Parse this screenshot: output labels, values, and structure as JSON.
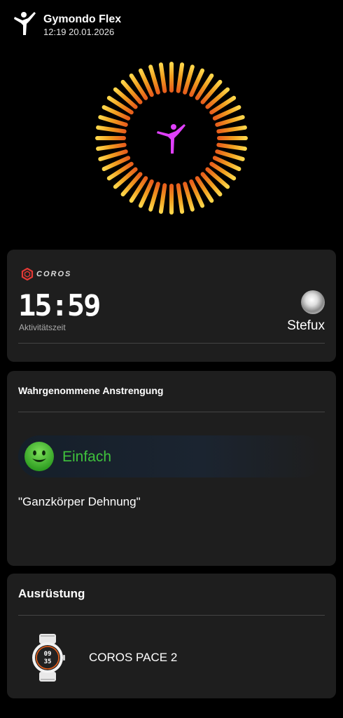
{
  "header": {
    "title": "Gymondo Flex",
    "datetime": "12:19 20.01.2026",
    "icon": "yoga-pose-icon"
  },
  "hero": {
    "icon": "yoga-pose-icon",
    "ring_colors": [
      "#ffd54a",
      "#f0a020",
      "#e8601c"
    ],
    "figure_color": "#e040fb"
  },
  "coros_card": {
    "brand": "COROS",
    "activity_time": "15:59",
    "activity_time_label": "Aktivitätszeit",
    "user_name": "Stefux"
  },
  "effort_card": {
    "title": "Wahrgenommene Anstrengung",
    "level": "Einfach",
    "level_color": "#3fc23c",
    "workout_name": "\"Ganzkörper Dehnung\""
  },
  "gear_card": {
    "title": "Ausrüstung",
    "device_name": "COROS PACE 2",
    "watch_face": [
      "09",
      "35"
    ]
  }
}
